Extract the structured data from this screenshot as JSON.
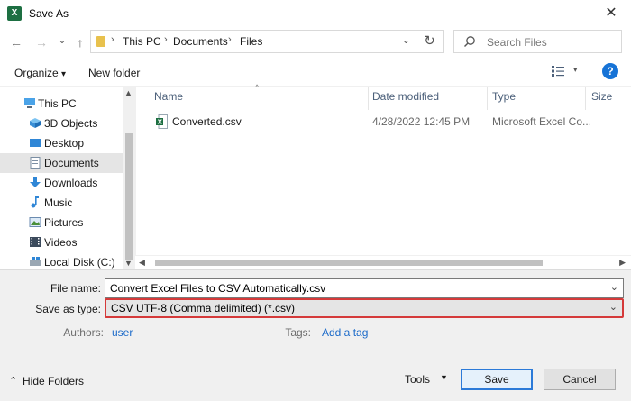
{
  "window": {
    "title": "Save As",
    "app_icon_glyph": "X",
    "close_glyph": "✕"
  },
  "nav": {
    "back": "←",
    "forward": "→",
    "recent": "⌄",
    "up": "↑"
  },
  "address": {
    "crumbs": [
      "This PC",
      "Documents",
      "Files"
    ],
    "separator": "›",
    "dropdown": "⌄",
    "refresh": "↻"
  },
  "search": {
    "placeholder": "Search Files"
  },
  "toolbar": {
    "organize": "Organize",
    "organize_arrow": "▾",
    "new_folder": "New folder",
    "view_arrow": "▾",
    "help": "?"
  },
  "sidebar": {
    "items": [
      {
        "label": "This PC",
        "icon": "computer-icon"
      },
      {
        "label": "3D Objects",
        "icon": "cube-icon"
      },
      {
        "label": "Desktop",
        "icon": "desktop-icon"
      },
      {
        "label": "Documents",
        "icon": "document-icon",
        "selected": true
      },
      {
        "label": "Downloads",
        "icon": "download-icon"
      },
      {
        "label": "Music",
        "icon": "music-icon"
      },
      {
        "label": "Pictures",
        "icon": "picture-icon"
      },
      {
        "label": "Videos",
        "icon": "video-icon"
      },
      {
        "label": "Local Disk (C:)",
        "icon": "disk-icon"
      }
    ],
    "scroll_up": "▲",
    "scroll_down": "▼"
  },
  "files": {
    "columns": [
      "Name",
      "Date modified",
      "Type",
      "Size"
    ],
    "sort_arrow": "^",
    "rows": [
      {
        "name": "Converted.csv",
        "date": "4/28/2022 12:45 PM",
        "type": "Microsoft Excel Co..."
      }
    ],
    "hscroll_left": "◀",
    "hscroll_right": "▶"
  },
  "form": {
    "filename_label": "File name:",
    "filename_value": "Convert Excel Files to CSV Automatically.csv",
    "type_label": "Save as type:",
    "type_value": "CSV UTF-8 (Comma delimited) (*.csv)",
    "dropdown": "⌄",
    "authors_label": "Authors:",
    "authors_value": "user",
    "tags_label": "Tags:",
    "tags_value": "Add a tag",
    "highlight_color": "#d53a3a"
  },
  "footer": {
    "hide_folders": "Hide Folders",
    "hide_chevron": "⌃",
    "tools": "Tools",
    "tools_arrow": "▼",
    "save": "Save",
    "cancel": "Cancel"
  }
}
